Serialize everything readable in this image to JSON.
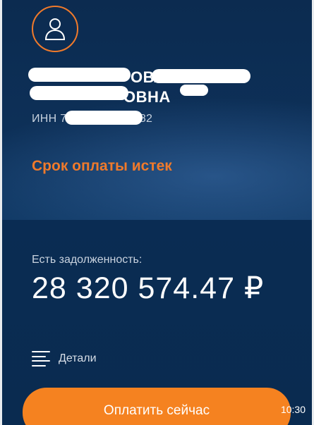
{
  "profile": {
    "name_line1": "ОВА",
    "name_line2": "ОВНА",
    "inn_prefix": "ИНН 7",
    "inn_suffix": "5582"
  },
  "status": {
    "overdue_text": "Срок оплаты истек"
  },
  "debt": {
    "label": "Есть задолженность:",
    "amount": "28 320 574.47 ₽"
  },
  "details": {
    "label": "Детали"
  },
  "actions": {
    "pay_label": "Оплатить сейчас"
  },
  "system": {
    "time": "10:30"
  },
  "colors": {
    "accent": "#f07a2b",
    "button": "#f58220",
    "background": "#0b2c52"
  }
}
